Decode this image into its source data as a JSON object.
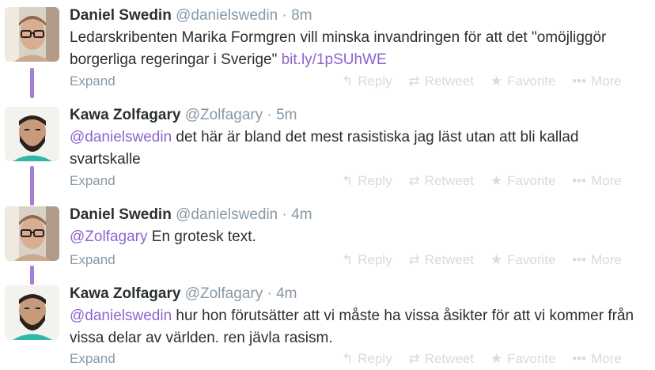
{
  "tweets": [
    {
      "fullname": "Daniel Swedin",
      "username": "@danielswedin",
      "time": "· 8m",
      "text_parts": [
        {
          "text": "Ledarskribenten Marika Formgren vill minska invandringen för att det \"omöjliggör borgerliga regeringar i Sverige\" ",
          "type": "plain"
        },
        {
          "text": "bit.ly/1pSUhWE",
          "type": "link"
        }
      ],
      "expand": "Expand"
    },
    {
      "fullname": "Kawa Zolfagary",
      "username": "@Zolfagary",
      "time": "· 5m",
      "text_parts": [
        {
          "text": "@danielswedin",
          "type": "mention"
        },
        {
          "text": " det här är bland det mest rasistiska jag läst utan att bli kallad svartskalle",
          "type": "plain"
        }
      ],
      "expand": "Expand"
    },
    {
      "fullname": "Daniel Swedin",
      "username": "@danielswedin",
      "time": "· 4m",
      "text_parts": [
        {
          "text": "@Zolfagary",
          "type": "mention"
        },
        {
          "text": " En grotesk text.",
          "type": "plain"
        }
      ],
      "expand": "Expand"
    },
    {
      "fullname": "Kawa Zolfagary",
      "username": "@Zolfagary",
      "time": "· 4m",
      "text_parts": [
        {
          "text": "@danielswedin",
          "type": "mention"
        },
        {
          "text": " hur hon förutsätter att vi måste ha vissa åsikter för att vi kommer från vissa delar av världen. ren jävla rasism.",
          "type": "plain"
        }
      ],
      "expand": "Expand"
    }
  ],
  "actions": {
    "reply": "Reply",
    "retweet": "Retweet",
    "favorite": "Favorite",
    "more": "More"
  },
  "icons": {
    "reply": "reply-icon",
    "retweet": "retweet-icon",
    "favorite": "star-icon",
    "more": "ellipsis-icon"
  },
  "colors": {
    "accent": "#8b64d0",
    "connector": "#a47fd6",
    "muted": "#8899a6",
    "action_gray": "#d4dbe1"
  }
}
